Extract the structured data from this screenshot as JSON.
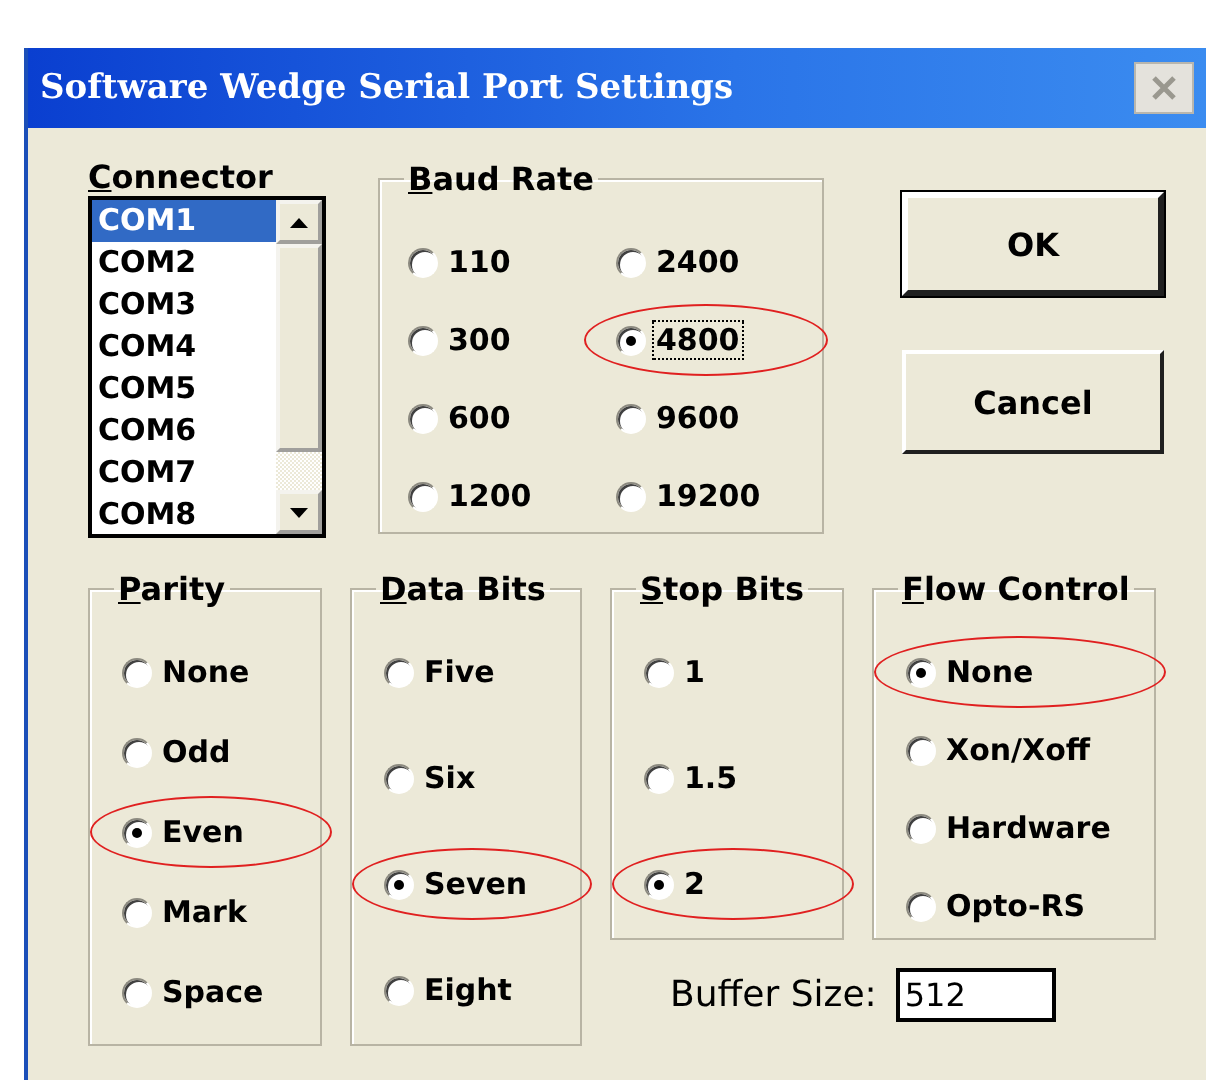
{
  "window": {
    "title": "Software Wedge Serial Port Settings"
  },
  "connector": {
    "label": "Connector",
    "items": [
      {
        "label": "COM1",
        "selected": true
      },
      {
        "label": "COM2",
        "selected": false
      },
      {
        "label": "COM3",
        "selected": false
      },
      {
        "label": "COM4",
        "selected": false
      },
      {
        "label": "COM5",
        "selected": false
      },
      {
        "label": "COM6",
        "selected": false
      },
      {
        "label": "COM7",
        "selected": false
      },
      {
        "label": "COM8",
        "selected": false
      }
    ]
  },
  "baud_rate": {
    "label": "Baud Rate",
    "options": [
      {
        "label": "110",
        "selected": false,
        "focused": false,
        "circled": false
      },
      {
        "label": "2400",
        "selected": false,
        "focused": false,
        "circled": false
      },
      {
        "label": "300",
        "selected": false,
        "focused": false,
        "circled": false
      },
      {
        "label": "4800",
        "selected": true,
        "focused": true,
        "circled": true
      },
      {
        "label": "600",
        "selected": false,
        "focused": false,
        "circled": false
      },
      {
        "label": "9600",
        "selected": false,
        "focused": false,
        "circled": false
      },
      {
        "label": "1200",
        "selected": false,
        "focused": false,
        "circled": false
      },
      {
        "label": "19200",
        "selected": false,
        "focused": false,
        "circled": false
      }
    ]
  },
  "buttons": [
    {
      "label": "OK",
      "default": true
    },
    {
      "label": "Cancel",
      "default": false
    }
  ],
  "option_groups": [
    {
      "label": "Parity",
      "options": [
        {
          "label": "None",
          "selected": false,
          "circled": false
        },
        {
          "label": "Odd",
          "selected": false,
          "circled": false
        },
        {
          "label": "Even",
          "selected": true,
          "circled": true
        },
        {
          "label": "Mark",
          "selected": false,
          "circled": false
        },
        {
          "label": "Space",
          "selected": false,
          "circled": false
        }
      ]
    },
    {
      "label": "Data Bits",
      "options": [
        {
          "label": "Five",
          "selected": false,
          "circled": false
        },
        {
          "label": "Six",
          "selected": false,
          "circled": false
        },
        {
          "label": "Seven",
          "selected": true,
          "circled": true
        },
        {
          "label": "Eight",
          "selected": false,
          "circled": false
        }
      ]
    },
    {
      "label": "Stop Bits",
      "options": [
        {
          "label": "1",
          "selected": false,
          "circled": false
        },
        {
          "label": "1.5",
          "selected": false,
          "circled": false
        },
        {
          "label": "2",
          "selected": true,
          "circled": true
        }
      ]
    },
    {
      "label": "Flow Control",
      "options": [
        {
          "label": "None",
          "selected": true,
          "circled": true
        },
        {
          "label": "Xon/Xoff",
          "selected": false,
          "circled": false
        },
        {
          "label": "Hardware",
          "selected": false,
          "circled": false
        },
        {
          "label": "Opto-RS",
          "selected": false,
          "circled": false
        }
      ]
    }
  ],
  "buffer_size": {
    "label": "Buffer Size:",
    "value": "512"
  }
}
